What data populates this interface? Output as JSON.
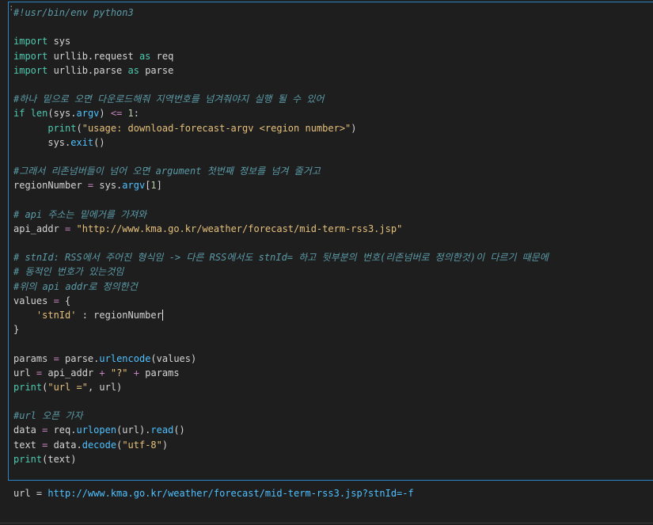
{
  "cell_marker": ":",
  "code_lines": [
    [
      {
        "t": "cm",
        "v": "#!usr/bin/env python3"
      }
    ],
    [],
    [
      {
        "t": "kw",
        "v": "import"
      },
      {
        "t": "pu",
        "v": " sys"
      }
    ],
    [
      {
        "t": "kw",
        "v": "import"
      },
      {
        "t": "pu",
        "v": " urllib.request "
      },
      {
        "t": "kw",
        "v": "as"
      },
      {
        "t": "pu",
        "v": " req"
      }
    ],
    [
      {
        "t": "kw",
        "v": "import"
      },
      {
        "t": "pu",
        "v": " urllib.parse "
      },
      {
        "t": "kw",
        "v": "as"
      },
      {
        "t": "pu",
        "v": " parse"
      }
    ],
    [],
    [
      {
        "t": "cm",
        "v": "#하나 밑으로 오면 다운로드해줘 지역번호를 넘겨줘야지 실행 될 수 있어"
      }
    ],
    [
      {
        "t": "kw",
        "v": "if"
      },
      {
        "t": "pu",
        "v": " "
      },
      {
        "t": "bi",
        "v": "len"
      },
      {
        "t": "pu",
        "v": "(sys."
      },
      {
        "t": "at",
        "v": "argv"
      },
      {
        "t": "pu",
        "v": ") "
      },
      {
        "t": "op",
        "v": "<="
      },
      {
        "t": "pu",
        "v": " "
      },
      {
        "t": "nm",
        "v": "1"
      },
      {
        "t": "pu",
        "v": ":"
      }
    ],
    [
      {
        "t": "pu",
        "v": "      "
      },
      {
        "t": "bi",
        "v": "print"
      },
      {
        "t": "pu",
        "v": "("
      },
      {
        "t": "st",
        "v": "\"usage: download-forecast-argv <region number>\""
      },
      {
        "t": "pu",
        "v": ")"
      }
    ],
    [
      {
        "t": "pu",
        "v": "      sys."
      },
      {
        "t": "at",
        "v": "exit"
      },
      {
        "t": "pu",
        "v": "()"
      }
    ],
    [],
    [
      {
        "t": "cm",
        "v": "#그래서 리존넘버들이 넘어 오면 argument 첫번째 정보를 넘겨 줄거고"
      }
    ],
    [
      {
        "t": "pu",
        "v": "regionNumber "
      },
      {
        "t": "op",
        "v": "="
      },
      {
        "t": "pu",
        "v": " sys."
      },
      {
        "t": "at",
        "v": "argv"
      },
      {
        "t": "br",
        "v": "["
      },
      {
        "t": "nm",
        "v": "1"
      },
      {
        "t": "br",
        "v": "]"
      }
    ],
    [],
    [
      {
        "t": "cm",
        "v": "# api 주소는 밑에거를 가져와"
      }
    ],
    [
      {
        "t": "pu",
        "v": "api_addr "
      },
      {
        "t": "op",
        "v": "="
      },
      {
        "t": "pu",
        "v": " "
      },
      {
        "t": "st",
        "v": "\"http://www.kma.go.kr/weather/forecast/mid-term-rss3.jsp\""
      }
    ],
    [],
    [
      {
        "t": "cm",
        "v": "# stnId: RSS에서 주어진 형식임 -> 다른 RSS에서도 stnId= 하고 뒷부분의 번호(리존넘버로 정의한것)이 다르기 때문에"
      }
    ],
    [
      {
        "t": "cm",
        "v": "# 동적인 번호가 있는것임"
      }
    ],
    [
      {
        "t": "cm",
        "v": "#위의 api addr로 정의한건"
      }
    ],
    [
      {
        "t": "pu",
        "v": "values "
      },
      {
        "t": "op",
        "v": "="
      },
      {
        "t": "pu",
        "v": " "
      },
      {
        "t": "br",
        "v": "{"
      }
    ],
    [
      {
        "t": "pu",
        "v": "    "
      },
      {
        "t": "st",
        "v": "'stnId'"
      },
      {
        "t": "pu",
        "v": " : regionNumber"
      },
      {
        "t": "cursor",
        "v": ""
      }
    ],
    [
      {
        "t": "br",
        "v": "}"
      }
    ],
    [],
    [
      {
        "t": "pu",
        "v": "params "
      },
      {
        "t": "op",
        "v": "="
      },
      {
        "t": "pu",
        "v": " parse."
      },
      {
        "t": "at",
        "v": "urlencode"
      },
      {
        "t": "pu",
        "v": "(values)"
      }
    ],
    [
      {
        "t": "pu",
        "v": "url "
      },
      {
        "t": "op",
        "v": "="
      },
      {
        "t": "pu",
        "v": " api_addr "
      },
      {
        "t": "op",
        "v": "+"
      },
      {
        "t": "pu",
        "v": " "
      },
      {
        "t": "st",
        "v": "\"?\""
      },
      {
        "t": "pu",
        "v": " "
      },
      {
        "t": "op",
        "v": "+"
      },
      {
        "t": "pu",
        "v": " params"
      }
    ],
    [
      {
        "t": "bi",
        "v": "print"
      },
      {
        "t": "pu",
        "v": "("
      },
      {
        "t": "st",
        "v": "\"url =\""
      },
      {
        "t": "pu",
        "v": ", url)"
      }
    ],
    [],
    [
      {
        "t": "cm",
        "v": "#url 오픈 가자"
      }
    ],
    [
      {
        "t": "pu",
        "v": "data "
      },
      {
        "t": "op",
        "v": "="
      },
      {
        "t": "pu",
        "v": " req."
      },
      {
        "t": "at",
        "v": "urlopen"
      },
      {
        "t": "pu",
        "v": "(url)."
      },
      {
        "t": "at",
        "v": "read"
      },
      {
        "t": "pu",
        "v": "()"
      }
    ],
    [
      {
        "t": "pu",
        "v": "text "
      },
      {
        "t": "op",
        "v": "="
      },
      {
        "t": "pu",
        "v": " data."
      },
      {
        "t": "at",
        "v": "decode"
      },
      {
        "t": "pu",
        "v": "("
      },
      {
        "t": "st",
        "v": "\"utf-8\""
      },
      {
        "t": "pu",
        "v": ")"
      }
    ],
    [
      {
        "t": "bi",
        "v": "print"
      },
      {
        "t": "pu",
        "v": "(text)"
      }
    ]
  ],
  "output": {
    "prefix": "url = ",
    "link": "http://www.kma.go.kr/weather/forecast/mid-term-rss3.jsp?stnId=-f"
  },
  "colors": {
    "background": "#1e1e1e",
    "cell_border": "#2a86c9",
    "comment": "#5b9ba8",
    "keyword": "#4ec9b0",
    "string": "#e5c07b",
    "number": "#b5cea8",
    "operator": "#c586c0",
    "attribute": "#4fc1ff",
    "link": "#4fc1ff"
  }
}
